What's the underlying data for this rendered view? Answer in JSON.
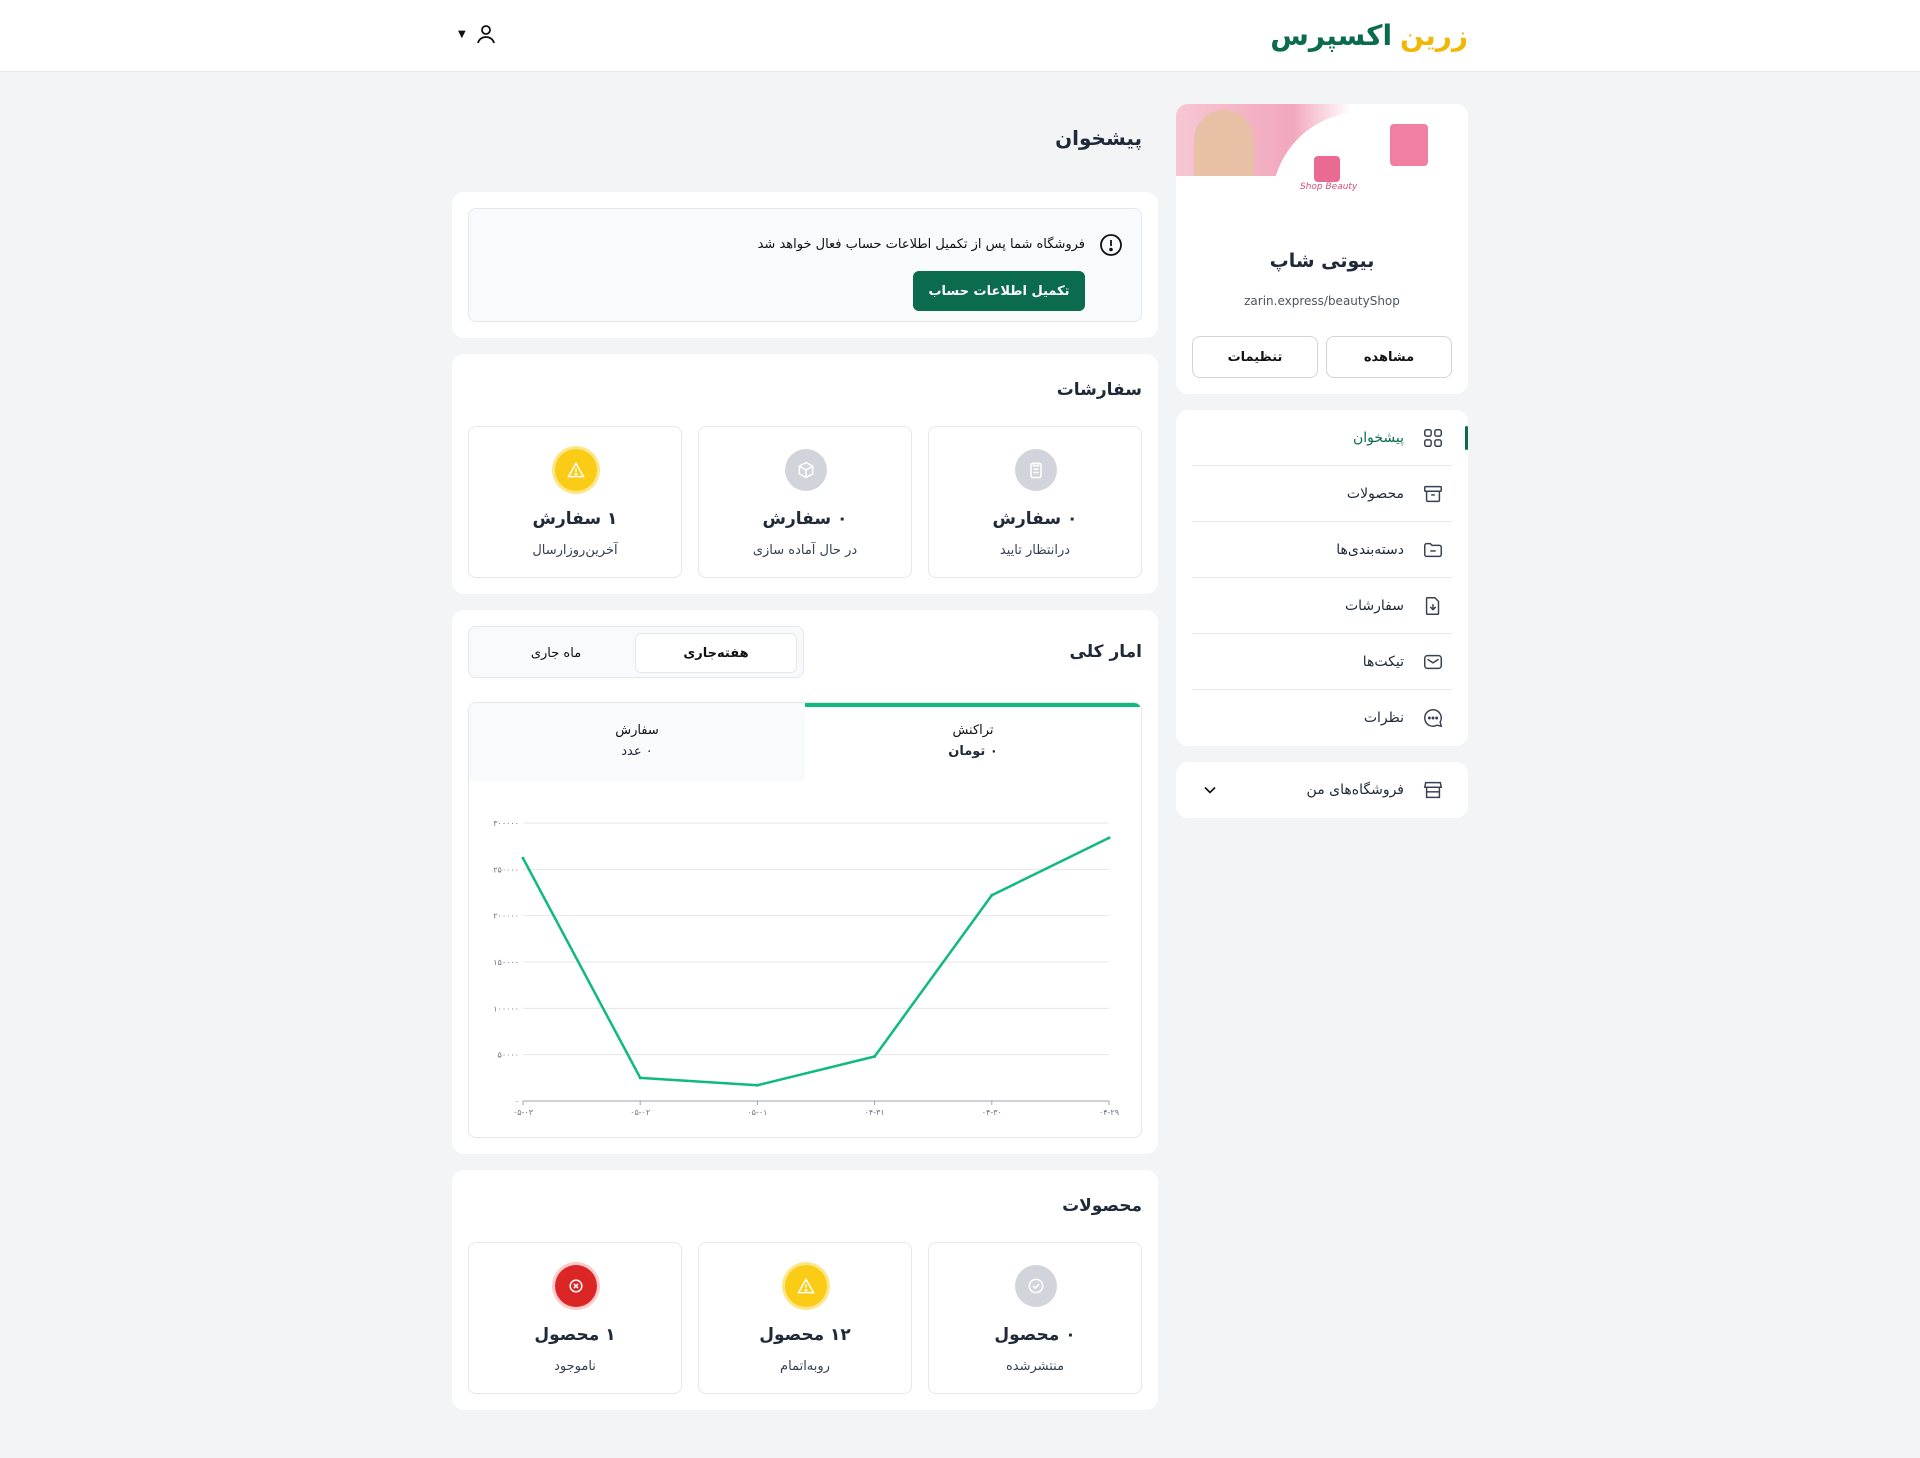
{
  "header": {
    "logo_part1": "زرین",
    "logo_part2": "اکسپرس"
  },
  "profile": {
    "store_name": "بیوتی شاپ",
    "store_url": "zarin.express/beautyShop",
    "banner_brand": "Shop Beauty",
    "view_label": "مشاهده",
    "settings_label": "تنظیمات"
  },
  "sidebar": {
    "items": [
      {
        "label": "پیشخوان",
        "icon": "grid-icon",
        "active": true
      },
      {
        "label": "محصولات",
        "icon": "archive-icon",
        "active": false
      },
      {
        "label": "دسته‌بندی‌ها",
        "icon": "folder-icon",
        "active": false
      },
      {
        "label": "سفارشات",
        "icon": "file-download-icon",
        "active": false
      },
      {
        "label": "تیکت‌ها",
        "icon": "mail-icon",
        "active": false
      },
      {
        "label": "نظرات",
        "icon": "chat-icon",
        "active": false
      }
    ],
    "my_stores_label": "فروشگاه‌های من"
  },
  "page": {
    "title": "پیشخوان"
  },
  "alert": {
    "message": "فروشگاه شما پس از تکمیل اطلاعات حساب فعال خواهد شد",
    "button_label": "تکمیل اطلاعات حساب"
  },
  "orders": {
    "title": "سفارشات",
    "stats": [
      {
        "count": "۰ سفارش",
        "label": "درانتظار تایید",
        "icon": "clipboard-icon"
      },
      {
        "count": "۰ سفارش",
        "label": "در حال آماده سازی",
        "icon": "box-icon"
      },
      {
        "count": "۱ سفارش",
        "label": "آخرین‌روزارسال",
        "icon": "warning-icon"
      }
    ]
  },
  "stats": {
    "title": "امار کلی",
    "segments": {
      "week": "هفته‌جاری",
      "month": "ماه جاری"
    },
    "metrics": [
      {
        "label": "تراکنش",
        "value": "۰ تومان"
      },
      {
        "label": "سفارش",
        "value": "۰ عدد"
      }
    ]
  },
  "chart_data": {
    "type": "line",
    "x": [
      "۰۵-۰۳",
      "۰۵-۰۲",
      "۰۵-۰۱",
      "۰۴-۳۱",
      "۰۴-۳۰",
      "۰۴-۲۹"
    ],
    "values": [
      262000,
      25000,
      17000,
      48000,
      222000,
      284000
    ],
    "ylim": [
      0,
      300000
    ],
    "yticks": [
      "۰",
      "۵۰۰۰۰",
      "۱۰۰۰۰۰",
      "۱۵۰۰۰۰",
      "۲۰۰۰۰۰",
      "۲۵۰۰۰۰",
      "۳۰۰۰۰۰"
    ],
    "yticks_values": [
      0,
      50000,
      100000,
      150000,
      200000,
      250000,
      300000
    ],
    "color": "#10b981",
    "grid": true
  },
  "products": {
    "title": "محصولات",
    "stats": [
      {
        "count": "۰ محصول",
        "label": "منتشرشده",
        "icon": "check-circle-icon"
      },
      {
        "count": "۱۲ محصول",
        "label": "روبه‌اتمام",
        "icon": "warning-icon"
      },
      {
        "count": "۱ محصول",
        "label": "ناموجود",
        "icon": "x-circle-icon"
      }
    ]
  },
  "colors": {
    "brand_green": "#0b6b4f",
    "brand_yellow": "#f2b705",
    "chart_line": "#10b981"
  }
}
